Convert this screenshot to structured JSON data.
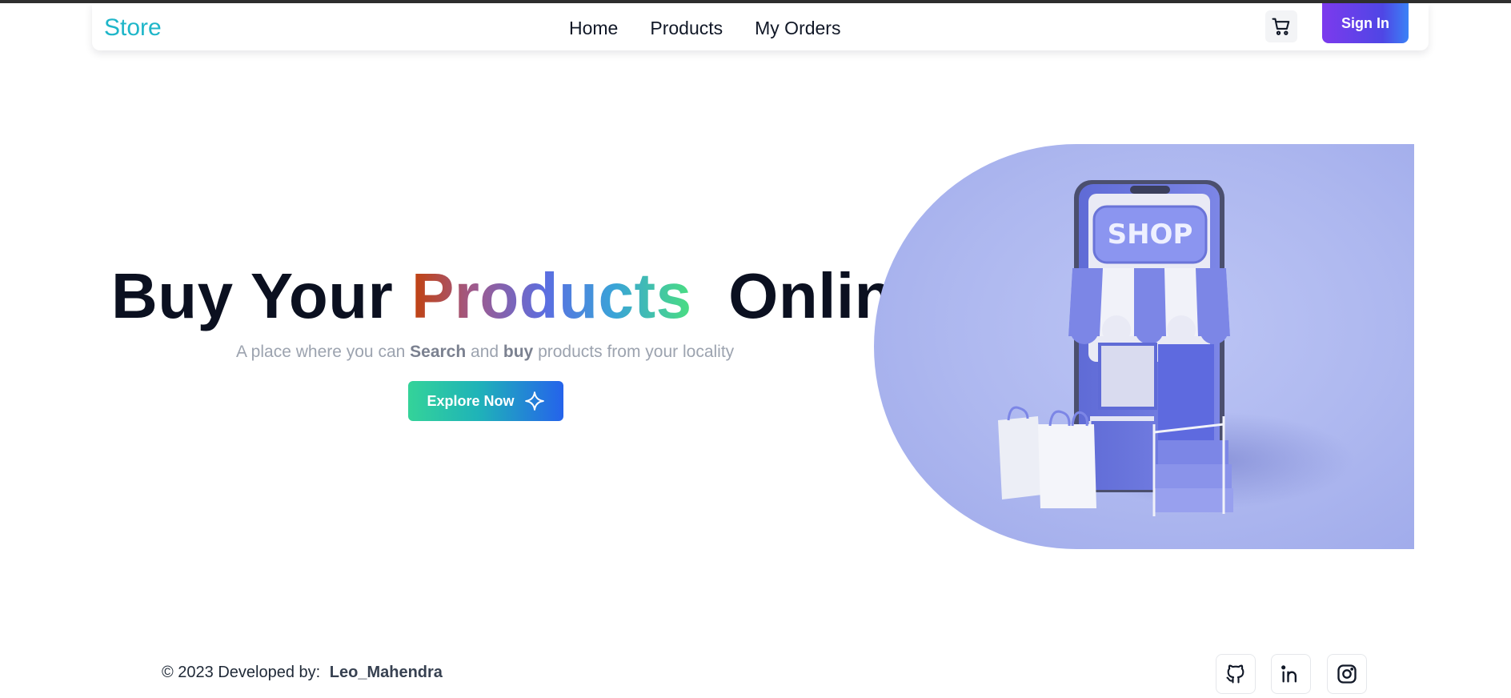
{
  "navbar": {
    "brand": "Store",
    "links": [
      "Home",
      "Products",
      "My Orders"
    ],
    "cart_icon": "cart-icon",
    "signin_label": "Sign In"
  },
  "hero": {
    "title_before": "Buy Your ",
    "title_highlight": "Products",
    "title_after": "  Online",
    "subtitle_part1": "A place where you can ",
    "subtitle_bold1": "Search",
    "subtitle_part2": " and ",
    "subtitle_bold2": "buy",
    "subtitle_part3": " products from your locality",
    "cta_label": "Explore Now",
    "cta_icon": "sparkle-icon",
    "image_sign_text": "SHOP"
  },
  "footer": {
    "copyright": "© 2023 Developed by:",
    "developer": "Leo_Mahendra",
    "social_icons": [
      "github-icon",
      "linkedin-icon",
      "instagram-icon"
    ]
  },
  "colors": {
    "brand": "#1fb6c9",
    "signin_gradient_start": "#7c3aed",
    "signin_gradient_end": "#3b82f6",
    "hero_bg": "#adb7ef"
  }
}
